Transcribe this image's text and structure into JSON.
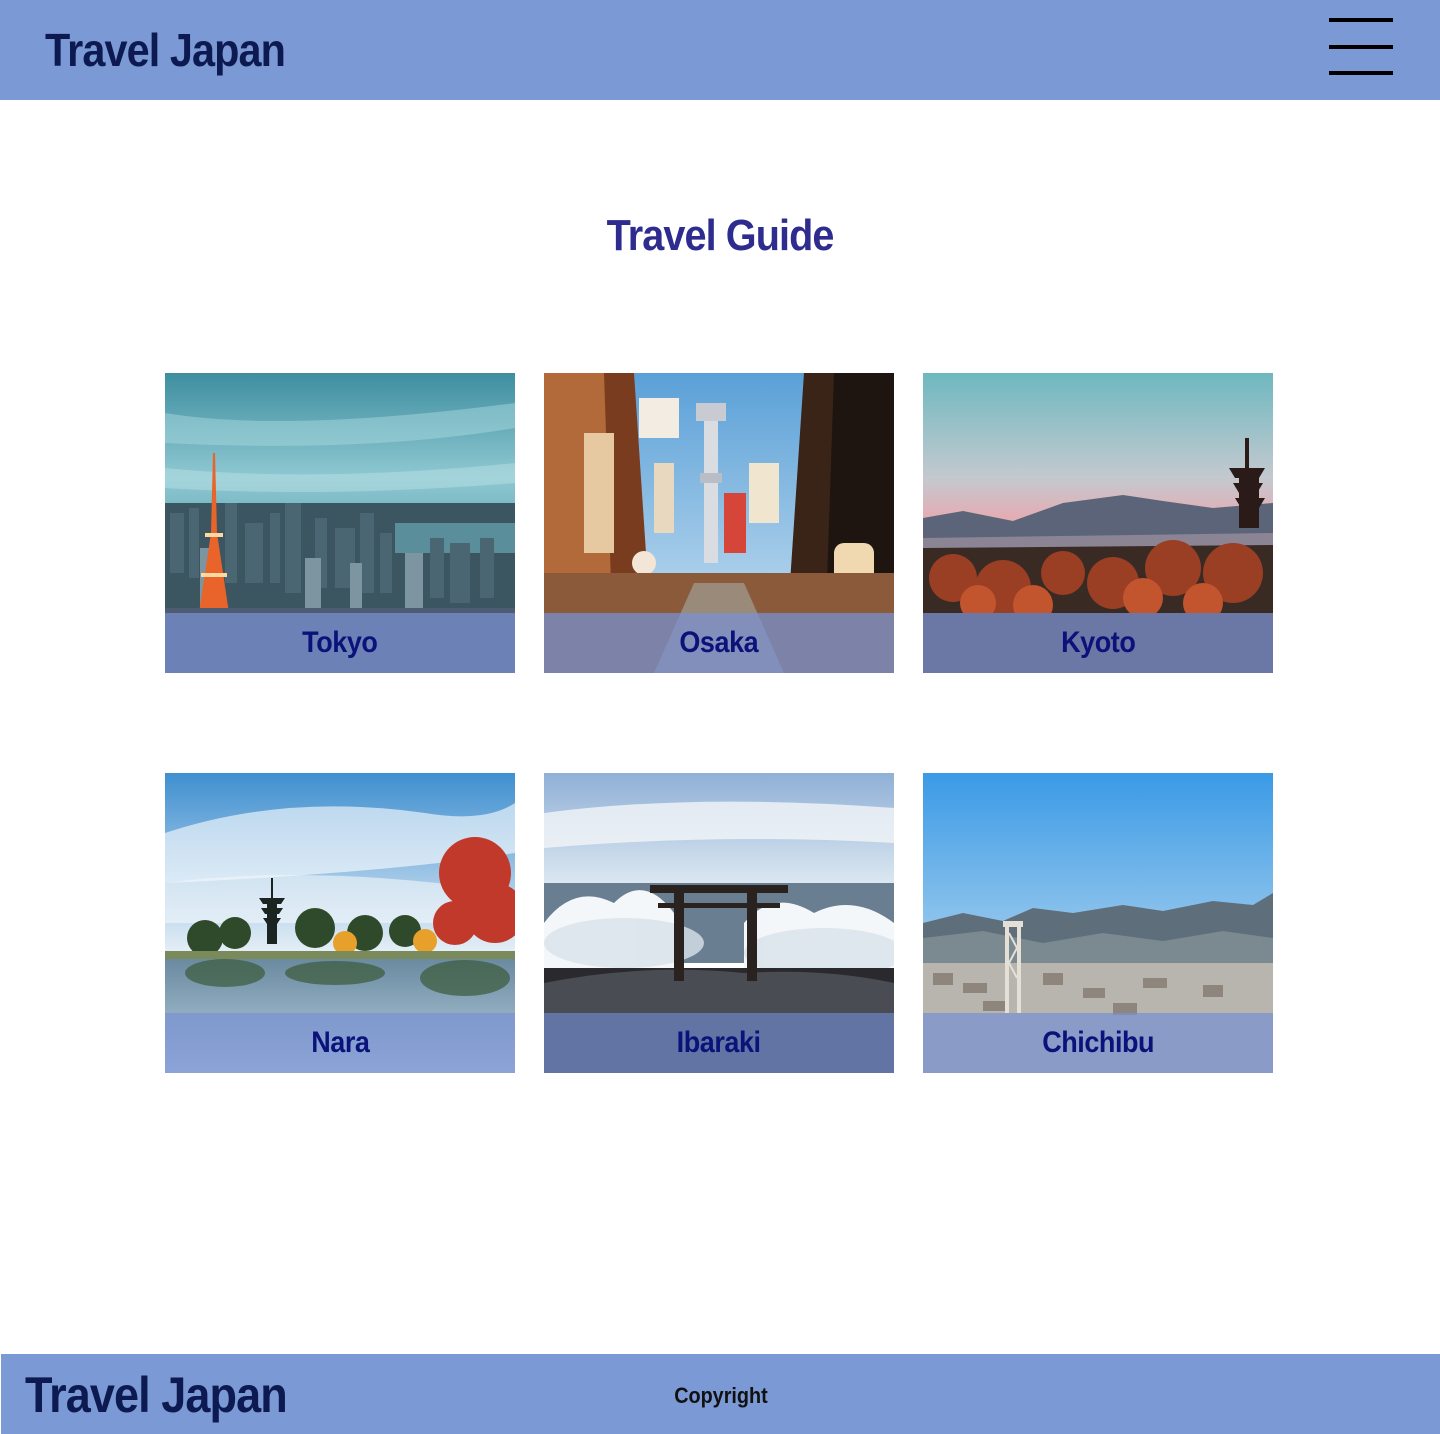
{
  "header": {
    "logo": "Travel Japan",
    "menu_icon": "hamburger-menu-icon"
  },
  "main": {
    "title": "Travel Guide",
    "cards": [
      {
        "id": "tokyo",
        "label": "Tokyo",
        "image": "tokyo-tower-skyline-photo"
      },
      {
        "id": "osaka",
        "label": "Osaka",
        "image": "osaka-shinsekai-street-photo"
      },
      {
        "id": "kyoto",
        "label": "Kyoto",
        "image": "kyoto-pagoda-sunset-photo"
      },
      {
        "id": "nara",
        "label": "Nara",
        "image": "nara-pagoda-pond-photo"
      },
      {
        "id": "ibaraki",
        "label": "Ibaraki",
        "image": "ibaraki-torii-waves-photo"
      },
      {
        "id": "chichibu",
        "label": "Chichibu",
        "image": "chichibu-bridge-mountains-photo"
      }
    ]
  },
  "footer": {
    "logo": "Travel Japan",
    "copyright": "Copyright"
  },
  "colors": {
    "header_bg": "#7b99d4",
    "logo_text": "#0d1a52",
    "title_text": "#2e2d8f",
    "caption_text": "#0b137a",
    "page_bg": "#ffffff"
  }
}
